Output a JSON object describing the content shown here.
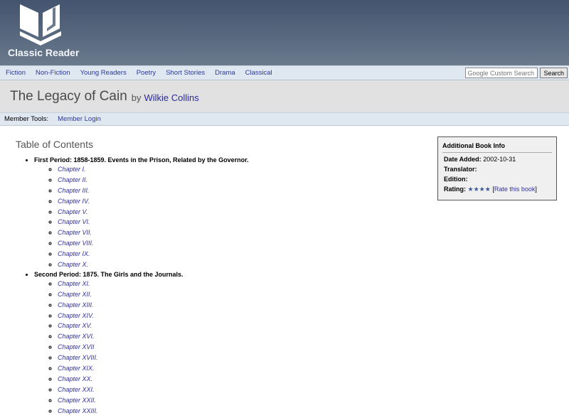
{
  "site": {
    "name": "Classic Reader"
  },
  "nav": {
    "items": [
      "Fiction",
      "Non-Fiction",
      "Young Readers",
      "Poetry",
      "Short Stories",
      "Drama",
      "Classical"
    ]
  },
  "search": {
    "placeholder": "Google Custom Search",
    "button": "Search"
  },
  "book": {
    "title": "The Legacy of Cain",
    "by": "by",
    "author": "Wilkie Collins"
  },
  "member": {
    "label": "Member Tools:",
    "login": "Member Login"
  },
  "toc": {
    "title": "Table of Contents",
    "periods": [
      {
        "label": "First Period: 1858-1859. Events in the Prison, Related by the Governor.",
        "chapters": [
          "Chapter I.",
          "Chapter II.",
          "Chapter III.",
          "Chapter IV.",
          "Chapter V.",
          "Chapter VI.",
          "Chapter VII.",
          "Chapter VIII.",
          "Chapter IX.",
          "Chapter X."
        ]
      },
      {
        "label": "Second Period: 1875. The Girls and the Journals.",
        "chapters": [
          "Chapter XI.",
          "Chapter XII.",
          "Chapter XIII.",
          "Chapter XIV.",
          "Chapter XV.",
          "Chapter XVI.",
          "Chapter XVII",
          "Chapter XVIII.",
          "Chapter XIX.",
          "Chapter XX.",
          "Chapter XXI.",
          "Chapter XXII.",
          "Chapter XXIII."
        ]
      }
    ]
  },
  "info": {
    "title": "Additional Book Info",
    "date_label": "Date Added:",
    "date_value": "2002-10-31",
    "translator_label": "Translator:",
    "edition_label": "Edition:",
    "rating_label": "Rating:",
    "rating_stars": "★★★★",
    "rating_value": 4,
    "rate_link": "Rate this book",
    "bracket_open": "[",
    "bracket_close": "]"
  },
  "colors": {
    "link": "#3030a0",
    "header": "#4a5a74",
    "nav_bg": "#dfe7f1"
  }
}
